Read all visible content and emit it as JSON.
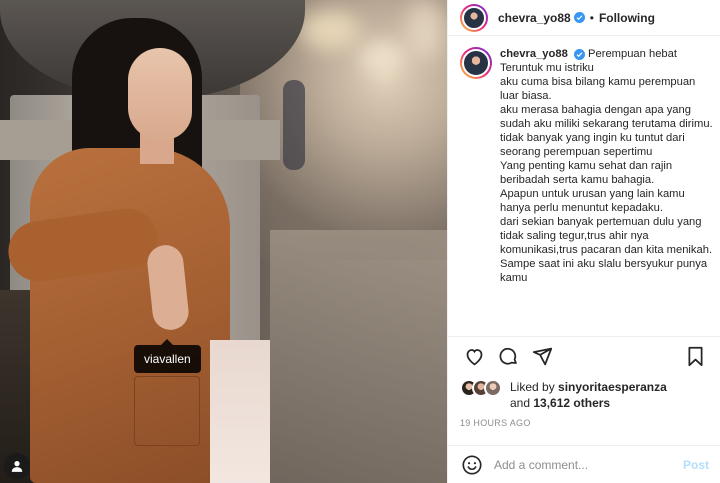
{
  "post": {
    "username": "chevra_yo88",
    "follow_status": "Following",
    "separator": "•",
    "photo_tag": "viavallen",
    "caption_lines": [
      "Perempuan hebat",
      "Teruntuk mu istriku",
      "aku cuma bisa bilang kamu perempuan luar biasa.",
      "aku merasa bahagia dengan apa yang sudah aku miliki sekarang terutama dirimu.",
      "tidak banyak yang ingin ku tuntut dari seorang perempuan sepertimu",
      "Yang penting kamu sehat dan rajin beribadah serta kamu bahagia.",
      "Apapun untuk urusan yang lain kamu hanya perlu menuntut kepadaku.",
      "dari sekian banyak pertemuan dulu yang tidak saling tegur,trus ahir nya komunikasi,trus pacaran dan kita menikah.",
      "Sampe saat ini aku slalu bersyukur punya kamu"
    ],
    "likes": {
      "prefix": "Liked by",
      "user": "sinyoritaesperanza",
      "and": "and",
      "others": "13,612 others"
    },
    "time_ago": "19 HOURS AGO",
    "comment": {
      "placeholder": "Add a comment...",
      "post_label": "Post"
    }
  },
  "icons": [
    "verified-badge-icon",
    "heart-icon",
    "comment-icon",
    "share-icon",
    "bookmark-icon",
    "emoji-icon",
    "user-tag-icon"
  ],
  "colors": {
    "verified": "#3897f0",
    "post_button": "#b2dffc",
    "text": "#262626",
    "secondary_text": "#8e8e8e"
  }
}
